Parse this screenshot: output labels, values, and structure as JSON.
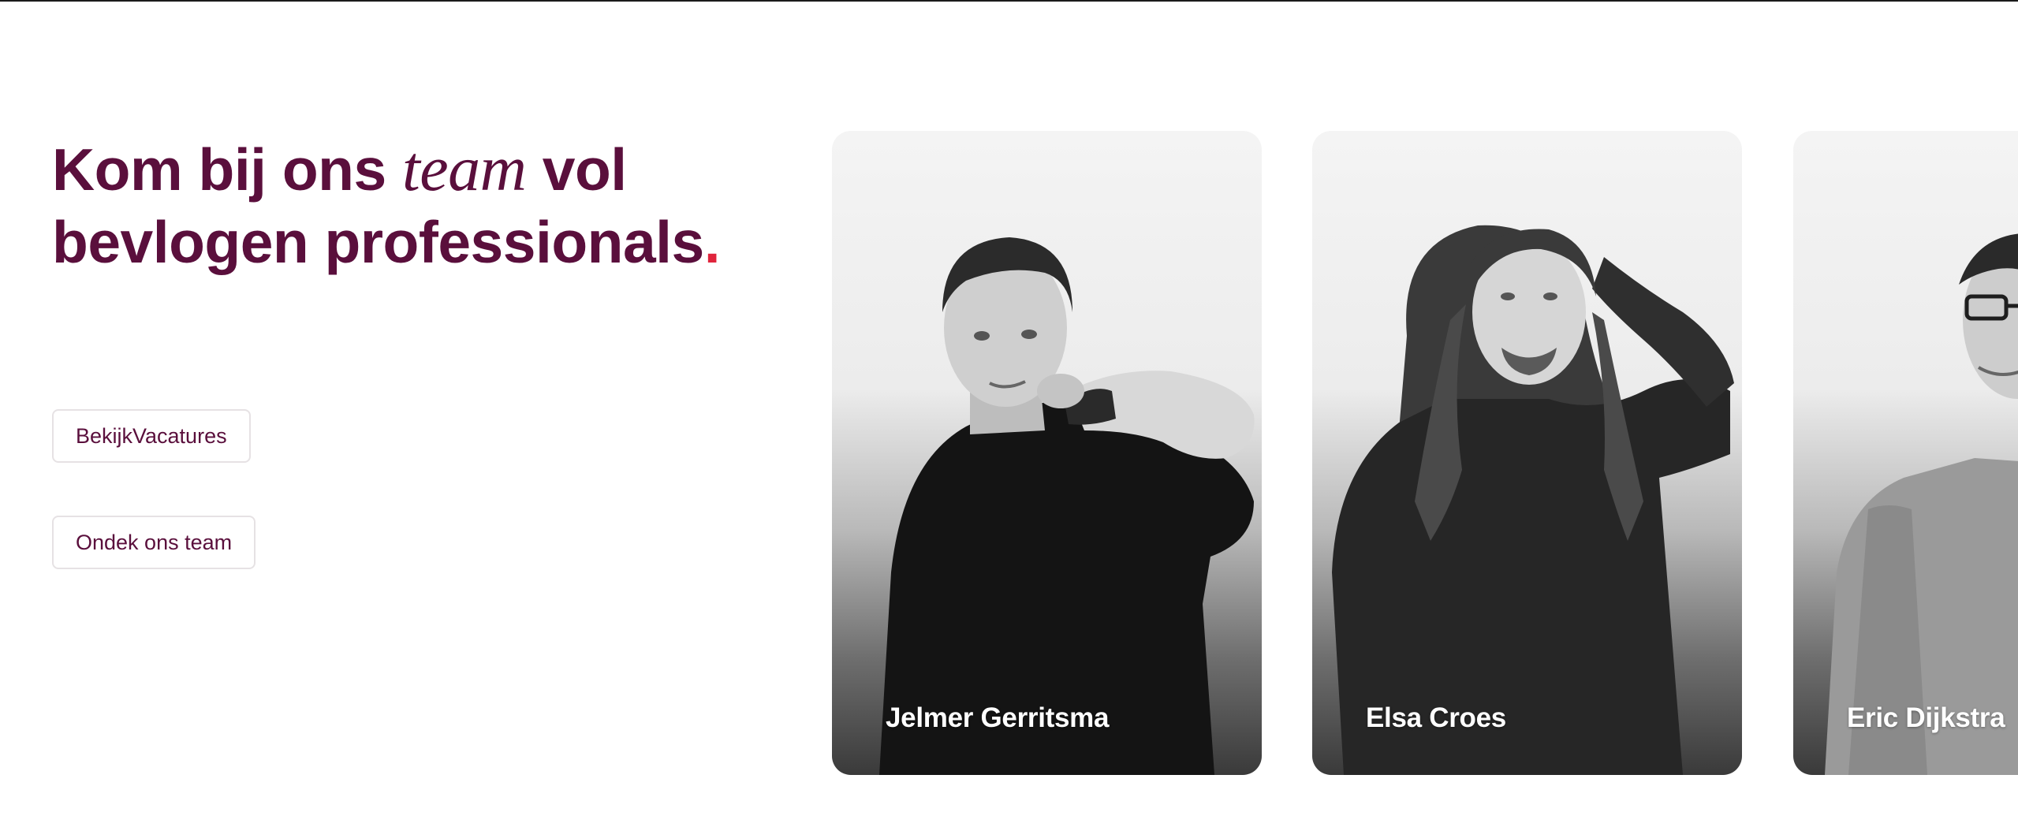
{
  "hero": {
    "headline_part1": "Kom bij ons ",
    "headline_italic": "team",
    "headline_part2": " vol",
    "headline_line2": "bevlogen professionals",
    "headline_dot": "."
  },
  "buttons": {
    "vacatures_label": "BekijkVacatures",
    "team_label": "Ondek ons team"
  },
  "team_cards": [
    {
      "name": "Jelmer Gerritsma"
    },
    {
      "name": "Elsa Croes"
    },
    {
      "name": "Eric Dijkstra"
    }
  ],
  "colors": {
    "brand": "#5a0f3c",
    "accent_dot": "#e0243c",
    "button_border": "#e6e2e4"
  }
}
